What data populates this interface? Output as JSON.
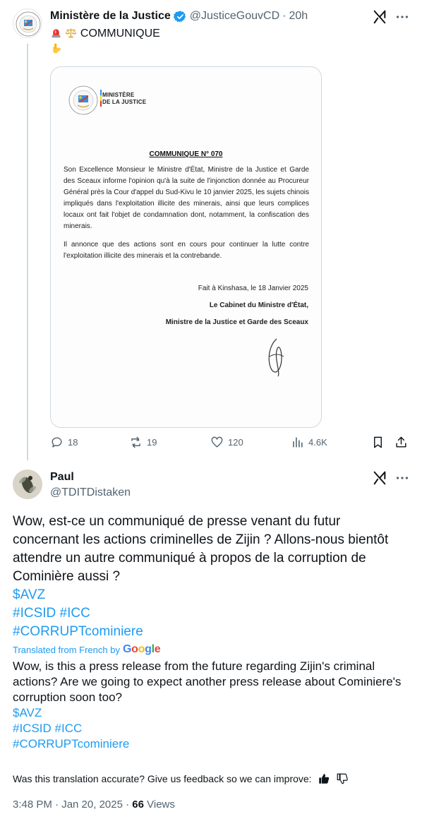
{
  "parent": {
    "display_name": "Ministère de la Justice",
    "handle": "@JusticeGouvCD",
    "separator": "·",
    "time": "20h",
    "text": "COMMUNIQUE",
    "emoji_icons": [
      "rotating-light-icon",
      "balance-scale-icon",
      "pointing-down-icon"
    ],
    "document": {
      "header": "MINISTÈRE",
      "header2": "DE LA JUSTICE",
      "title": "COMMUNIQUE N° 070",
      "para1": "Son Excellence Monsieur le Ministre d'État, Ministre de la Justice et Garde des Sceaux informe l'opinion qu'à la suite de l'injonction donnée au Procureur Général près la Cour d'appel du Sud-Kivu le 10 janvier 2025, les sujets chinois impliqués dans l'exploitation illicite des minerais, ainsi que leurs complices locaux ont fait l'objet de condamnation dont, notamment, la confiscation des minerais.",
      "para2": "Il annonce que des actions sont en cours pour continuer la lutte contre l'exploitation illicite des minerais et la contrebande.",
      "place_date": "Fait à Kinshasa, le 18 Janvier 2025",
      "signatory1": "Le Cabinet du Ministre d'État,",
      "signatory2": "Ministre de la Justice et Garde des Sceaux"
    },
    "stats": {
      "replies": "18",
      "reposts": "19",
      "likes": "120",
      "views": "4.6K"
    }
  },
  "reply": {
    "display_name": "Paul",
    "handle": "@TDITDistaken",
    "text": "Wow, est-ce un communiqué de presse venant du futur concernant les actions criminelles de Zijin ? Allons-nous bientôt attendre un autre communiqué à propos de la corruption de Cominière aussi ?",
    "tags_line1": "$AVZ",
    "tags_line2": "#ICSID #ICC",
    "tags_line3": "#CORRUPTcominiere",
    "translated_label": "Translated from French by",
    "translated_brand": "Google",
    "translation": "Wow, is this a press release from the future regarding Zijin's criminal actions? Are we going to expect another press release about Cominiere's corruption soon too?",
    "tr_tags_line1": "$AVZ",
    "tr_tags_line2": "#ICSID #ICC",
    "tr_tags_line3": "#CORRUPTcominiere",
    "feedback_prompt": "Was this translation accurate? Give us feedback so we can improve:",
    "timestamp": "3:48 PM · Jan 20, 2025 ·",
    "views_count": "66",
    "views_label": "Views"
  },
  "colors": {
    "link": "#1d9bf0",
    "muted": "#536471",
    "text": "#0f1419",
    "verified": "#1d9bf0"
  }
}
